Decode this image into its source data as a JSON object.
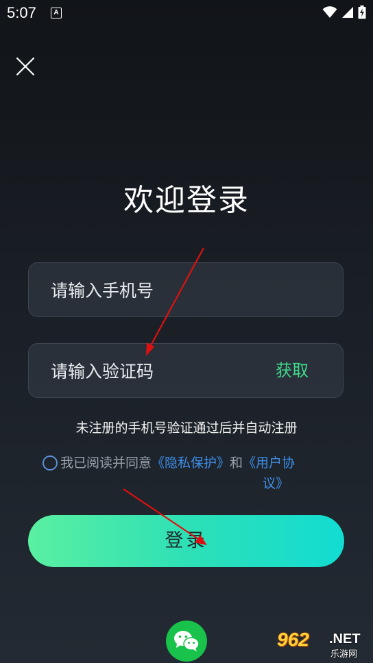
{
  "status_bar": {
    "time": "5:07",
    "notification_badge": "A",
    "icons": [
      "wifi-icon",
      "signal-icon",
      "battery-charging-icon"
    ]
  },
  "close_icon": "close-icon",
  "title": "欢迎登录",
  "phone_input": {
    "value": "",
    "placeholder": "请输入手机号"
  },
  "code_input": {
    "value": "",
    "placeholder": "请输入验证码",
    "get_code_label": "获取"
  },
  "notice": "未注册的手机号验证通过后并自动注册",
  "agreement": {
    "checked": false,
    "prefix": "我已阅读并同意",
    "privacy_link": "《隐私保护》",
    "and": "和",
    "terms_link_part1": "《用户协",
    "terms_link_part2": "议》"
  },
  "login_button": "登录",
  "social_login": {
    "icon": "wechat-icon"
  },
  "watermark": {
    "number": "962",
    "domain": ".NET",
    "site": "乐游网"
  },
  "colors": {
    "accent_green": "#40d98a",
    "link_blue": "#3d8ee8",
    "button_gradient_start": "#5af0a1",
    "button_gradient_end": "#12dcd2",
    "wechat_green": "#19c24a",
    "annotation_arrow": "#e01010"
  }
}
